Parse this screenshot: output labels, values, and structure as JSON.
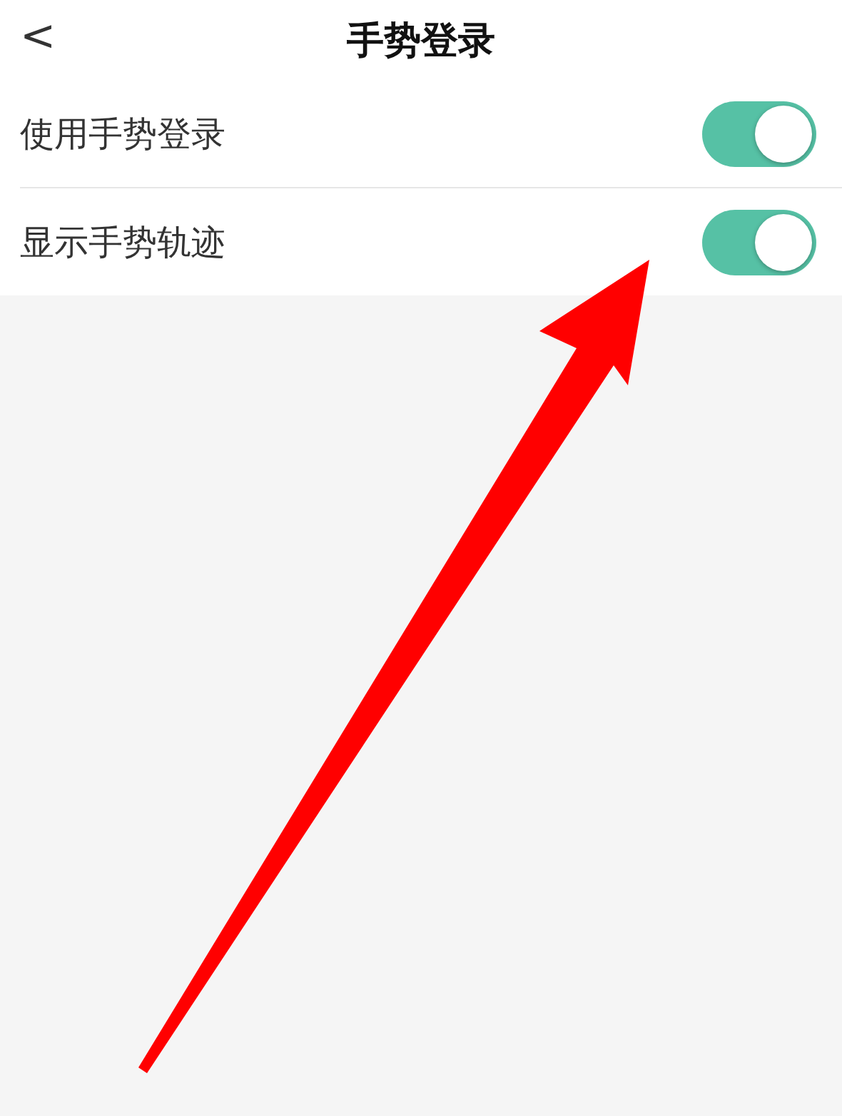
{
  "header": {
    "back": "<",
    "title": "手势登录"
  },
  "settings": [
    {
      "label": "使用手势登录",
      "on": true
    },
    {
      "label": "显示手势轨迹",
      "on": true
    }
  ]
}
